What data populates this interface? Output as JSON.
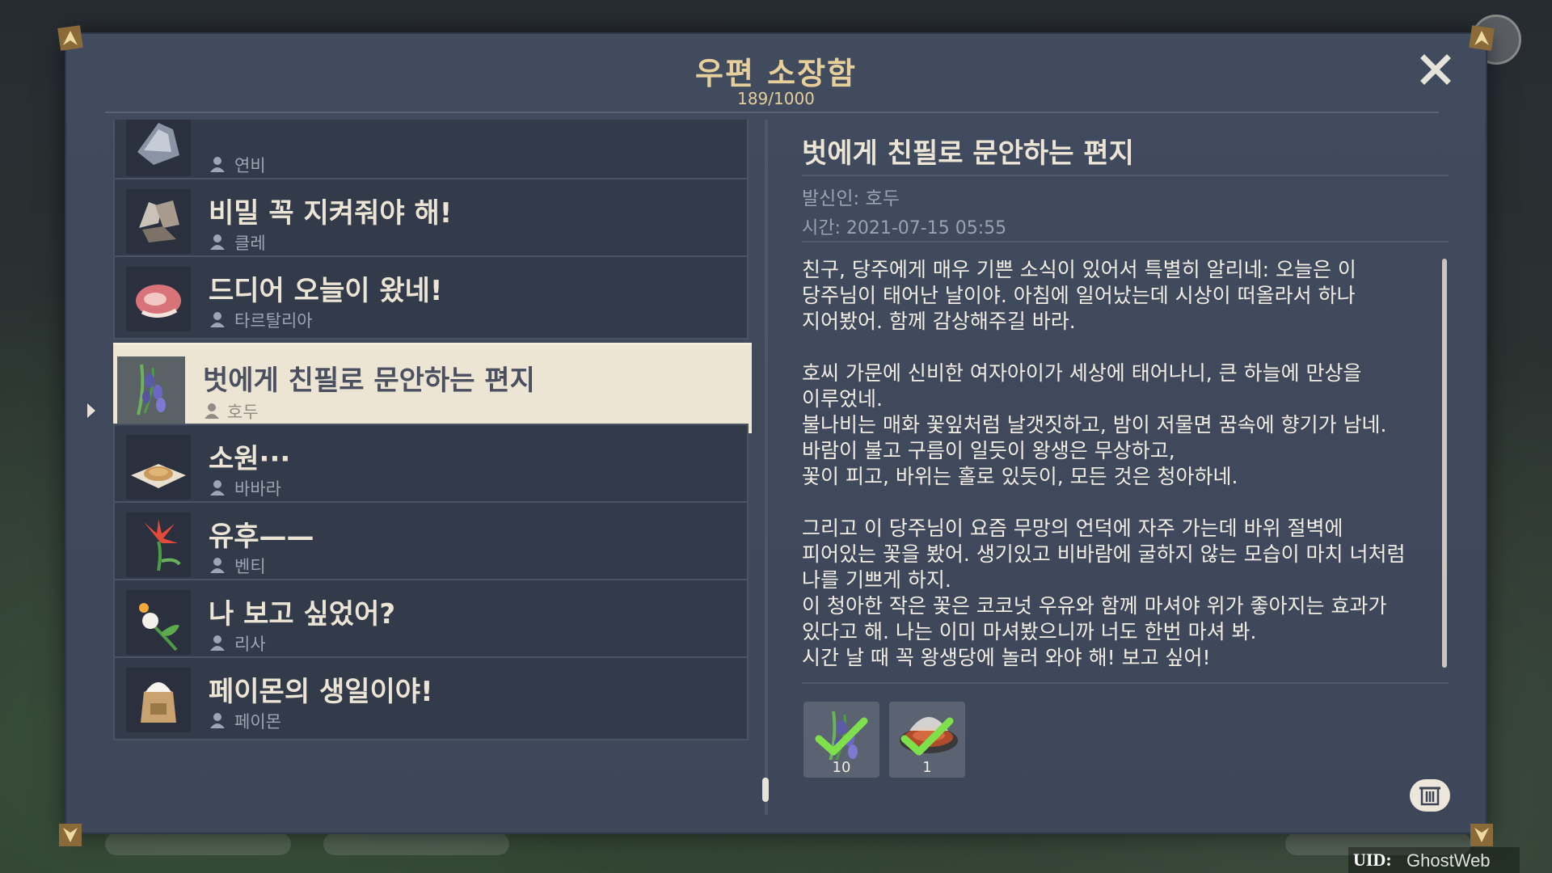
{
  "window": {
    "title": "우편 소장함",
    "count": "189/1000",
    "close_icon": "close-icon"
  },
  "mail_list": [
    {
      "subject": "",
      "sender": "연비",
      "icon": "ore-icon"
    },
    {
      "subject": "비밀 꼭 지켜줘야 해!",
      "sender": "클레",
      "icon": "crystal-chunk-icon"
    },
    {
      "subject": "드디어 오늘이 왔네!",
      "sender": "타르탈리아",
      "icon": "raw-meat-icon"
    },
    {
      "subject": "벗에게 친필로 문안하는 편지",
      "sender": "호두",
      "icon": "violetgrass-icon",
      "selected": true
    },
    {
      "subject": "소원···",
      "sender": "바바라",
      "icon": "pastry-icon"
    },
    {
      "subject": "유후——",
      "sender": "벤티",
      "icon": "lily-icon"
    },
    {
      "subject": "나 보고 싶었어?",
      "sender": "리사",
      "icon": "dandelion-icon"
    },
    {
      "subject": "페이몬의 생일이야!",
      "sender": "페이몬",
      "icon": "flour-sack-icon"
    }
  ],
  "detail": {
    "title": "벗에게 친필로 문안하는 편지",
    "sender_line": "발신인: 호두",
    "time_line": "시간: 2021-07-15 05:55",
    "paragraphs": [
      [
        "친구, 당주에게 매우 기쁜 소식이 있어서 특별히 알리네: 오늘은 이",
        "당주님이 태어난 날이야. 아침에 일어났는데 시상이 떠올라서 하나",
        "지어봤어. 함께 감상해주길 바라."
      ],
      [
        "호씨 가문에 신비한 여자아이가 세상에 태어나니, 큰 하늘에 만상을",
        "이루었네.",
        "불나비는 매화 꽃잎처럼 날갯짓하고, 밤이 저물면 꿈속에 향기가 남네.",
        "바람이 불고 구름이 일듯이 왕생은 무상하고,",
        "꽃이 피고, 바위는 홀로 있듯이, 모든 것은  청아하네."
      ],
      [
        "그리고 이 당주님이 요즘 무망의 언덕에 자주 가는데 바위 절벽에",
        "피어있는 꽃을 봤어. 생기있고 비바람에 굴하지 않는 모습이 마치 너처럼",
        "나를 기쁘게 하지.",
        "이 청아한 작은 꽃은 코코넛 우유와 함께 마셔야 위가 좋아지는 효과가",
        "있다고 해. 나는 이미 마셔봤으니까 너도 한번 마셔 봐.",
        "시간 날 때 꼭 왕생당에 놀러 와야 해! 보고 싶어!"
      ]
    ],
    "attachments": [
      {
        "icon": "violetgrass-icon",
        "qty": "10",
        "claimed": true
      },
      {
        "icon": "steak-dish-icon",
        "qty": "1",
        "claimed": true
      }
    ]
  },
  "footer": {
    "uid_label": "UID:",
    "uid_value": "GhostWeb"
  },
  "colors": {
    "accent_gold": "#e6cf9b",
    "panel": "#414b5e",
    "selected_bg": "#ede5d3",
    "text_light": "#f2ede2"
  }
}
